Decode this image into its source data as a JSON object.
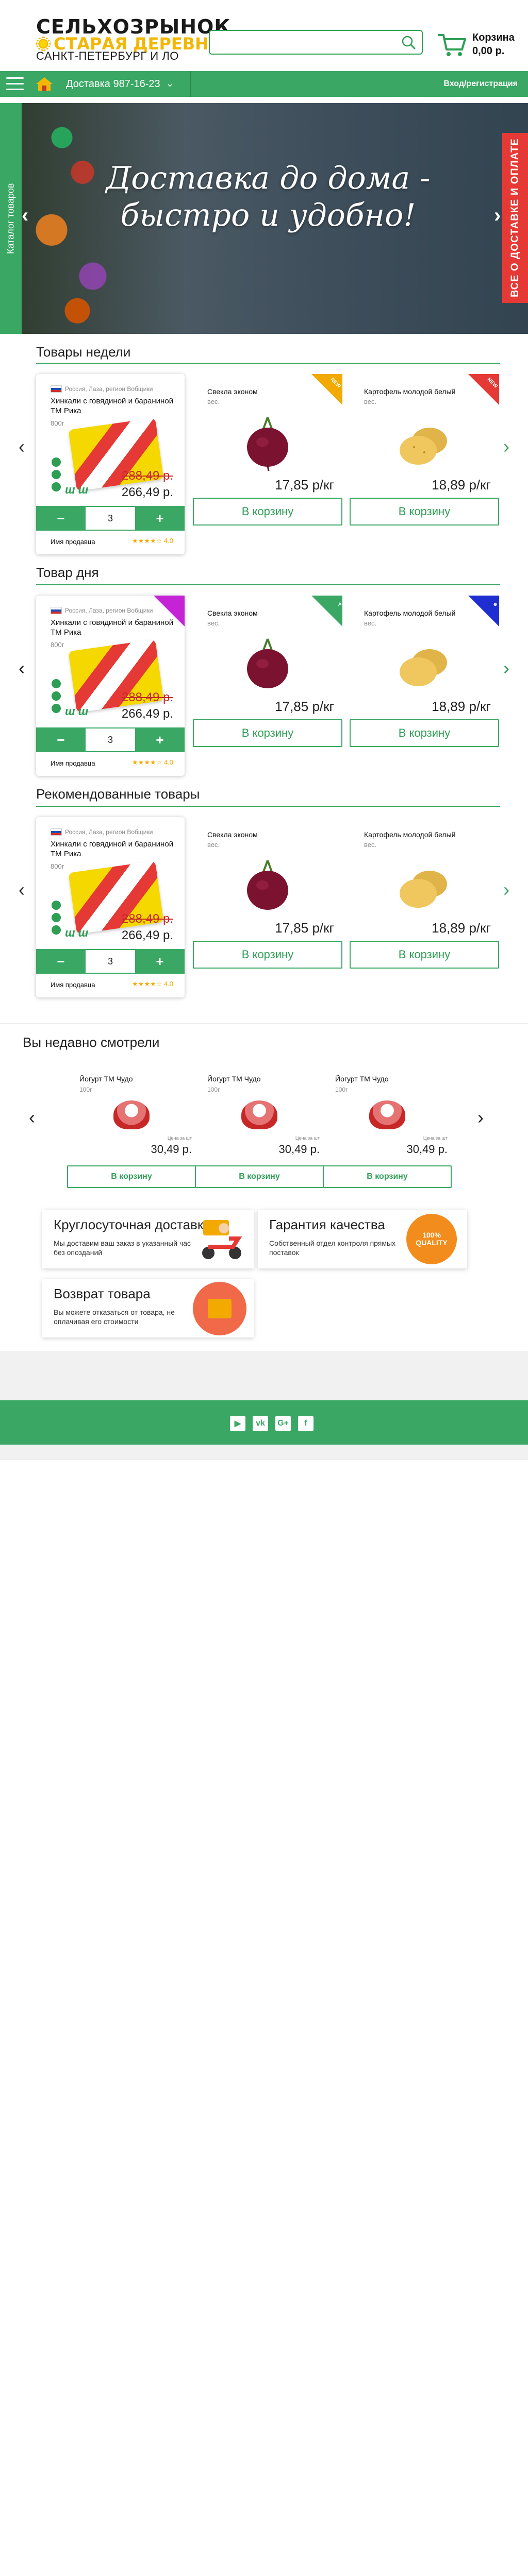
{
  "header": {
    "logo_line1": "СЕЛЬХОЗРЫНОК",
    "logo_line2": "СТАРАЯ ДЕРЕВНЯ",
    "city": "САНКТ-ПЕТЕРБУРГ И ЛО",
    "cart_label": "Корзина",
    "cart_sum": "0,00 р."
  },
  "nav": {
    "delivery": "Доставка  987-16-23",
    "login": "Вход/регистрация"
  },
  "banner": {
    "title": "Доставка до дома - быстро и удобно!"
  },
  "side": {
    "catalog": "Каталог товаров",
    "delivery_info": "ВСЕ О ДОСТАВКЕ И ОПЛАТЕ"
  },
  "sections": [
    {
      "title": "Товары недели",
      "main": {
        "origin": "Россия, Лаза, регион Вобщики",
        "name": "Хинкали с говядиной и бараниной ТМ Рика",
        "weight": "800г",
        "badge_text": "ш ш",
        "old_price": "288,49 р.",
        "new_price": "266,49 р.",
        "qty": "3",
        "minus": "−",
        "plus": "+",
        "seller": "Имя продавца",
        "rating": "★★★★☆ 4.0"
      },
      "items": [
        {
          "name": "Свекла эконом",
          "weight": "вес.",
          "price": "17,85 р/кг",
          "button": "В корзину",
          "corner": "NEW"
        },
        {
          "name": "Картофель молодой белый",
          "weight": "вес.",
          "price": "18,89 р/кг",
          "button": "В корзину",
          "corner": "NEW"
        }
      ]
    },
    {
      "title": "Товар дня",
      "main": {
        "origin": "Россия, Лаза, регион Вобщики",
        "name": "Хинкали с говядиной и бараниной ТМ Рика",
        "weight": "800г",
        "badge_text": "ш ш",
        "old_price": "288,49 р.",
        "new_price": "266,49 р.",
        "qty": "3",
        "minus": "−",
        "plus": "+",
        "seller": "Имя продавца",
        "rating": "★★★★☆ 4.0"
      },
      "items": [
        {
          "name": "Свекла эконом",
          "weight": "вес.",
          "price": "17,85 р/кг",
          "button": "В корзину",
          "corner": "✝"
        },
        {
          "name": "Картофель молодой белый",
          "weight": "вес.",
          "price": "18,89 р/кг",
          "button": "В корзину",
          "corner": "☻"
        }
      ]
    },
    {
      "title": "Рекомендованные товары",
      "main": {
        "origin": "Россия, Лаза, регион Вобщики",
        "name": "Хинкали с говядиной и бараниной ТМ Рика",
        "weight": "800г",
        "badge_text": "ш ш",
        "old_price": "288,49 р.",
        "new_price": "266,49 р.",
        "qty": "3",
        "minus": "−",
        "plus": "+",
        "seller": "Имя продавца",
        "rating": "★★★★☆ 4.0"
      },
      "items": [
        {
          "name": "Свекла эконом",
          "weight": "вес.",
          "price": "17,85 р/кг",
          "button": "В корзину"
        },
        {
          "name": "Картофель молодой белый",
          "weight": "вес.",
          "price": "18,89 р/кг",
          "button": "В корзину"
        }
      ]
    }
  ],
  "recent": {
    "title": "Вы недавно смотрели",
    "items": [
      {
        "name": "Йогурт ТМ Чудо",
        "weight": "100г",
        "unit": "Цена за шт",
        "price": "30,49 р.",
        "button": "В корзину"
      },
      {
        "name": "Йогурт ТМ Чудо",
        "weight": "100г",
        "unit": "Цена за шт",
        "price": "30,49 р.",
        "button": "В корзину"
      },
      {
        "name": "Йогурт ТМ Чудо",
        "weight": "100г",
        "unit": "Цена за шт",
        "price": "30,49 р.",
        "button": "В корзину"
      }
    ]
  },
  "features": [
    {
      "title": "Круглосуточная доставка",
      "desc": "Мы доставим ваш заказ в указанный час без опозданий"
    },
    {
      "title": "Гарантия качества",
      "desc": "Собственный отдел контроля прямых поставок",
      "badge": "100% QUALITY"
    },
    {
      "title": "Возврат товара",
      "desc": "Вы можете отказаться от товара, не оплачивая его стоимости"
    }
  ],
  "social": [
    "▶",
    "vk",
    "G+",
    "f"
  ],
  "colors": {
    "brand_green": "#3aa864",
    "accent_yellow": "#f2b705",
    "alert_red": "#e53935"
  }
}
